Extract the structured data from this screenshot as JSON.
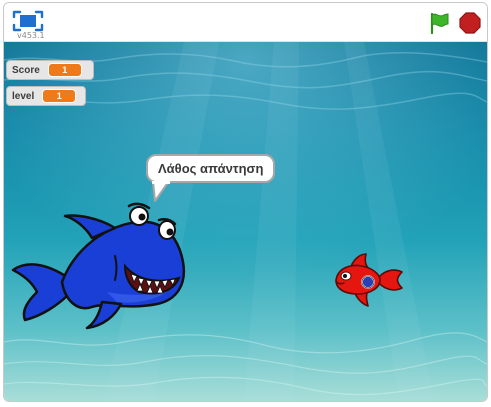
{
  "toolbar": {
    "fullscreen_icon": "fullscreen-icon",
    "version": "v453.1",
    "green_flag_icon": "green-flag-icon",
    "stop_icon": "stop-icon",
    "flag_color": "#3fb52a",
    "stop_color": "#c22020"
  },
  "stage": {
    "background": "underwater",
    "monitors": [
      {
        "label": "Score",
        "value": "1"
      },
      {
        "label": "level",
        "value": "1"
      }
    ],
    "speech_bubble": "Λάθος απάντηση",
    "sprites": [
      {
        "name": "blue-shark",
        "color": "#1a3fd6"
      },
      {
        "name": "red-fish",
        "color": "#e4160f"
      }
    ],
    "monitor_value_color": "#ef7a1a"
  }
}
